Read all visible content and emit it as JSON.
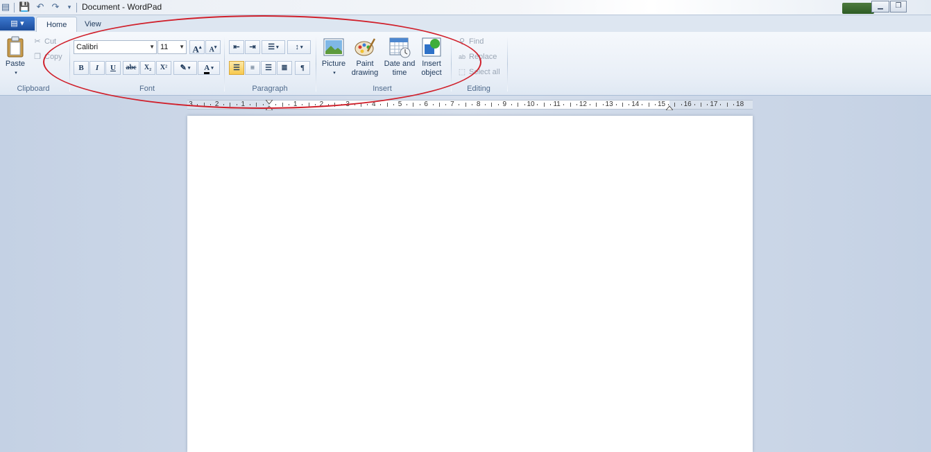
{
  "window": {
    "title": "Document - WordPad",
    "controls": {
      "minimize": "▁",
      "maximize": "❐"
    }
  },
  "tabs": [
    {
      "label": "Home",
      "active": true
    },
    {
      "label": "View",
      "active": false
    }
  ],
  "clipboard": {
    "group_label": "Clipboard",
    "paste": "Paste",
    "cut": "Cut",
    "copy": "Copy"
  },
  "font": {
    "group_label": "Font",
    "family": "Calibri",
    "size": "11",
    "grow": "A",
    "shrink": "A",
    "bold": "B",
    "italic": "I",
    "underline": "U",
    "strikethrough": "abc",
    "subscript": "X₂",
    "superscript": "X²",
    "font_color": "A"
  },
  "paragraph": {
    "group_label": "Paragraph"
  },
  "insert": {
    "group_label": "Insert",
    "picture": "Picture",
    "paint_line1": "Paint",
    "paint_line2": "drawing",
    "date_line1": "Date and",
    "date_line2": "time",
    "object_line1": "Insert",
    "object_line2": "object"
  },
  "editing": {
    "group_label": "Editing",
    "find": "Find",
    "replace": "Replace",
    "select_all": "Select all"
  },
  "ruler": {
    "left_numbers": [
      "3",
      "2",
      "1"
    ],
    "right_numbers": [
      "1",
      "2",
      "3",
      "4",
      "5",
      "6",
      "7",
      "8",
      "9",
      "10",
      "11",
      "12",
      "13",
      "14",
      "15",
      "16",
      "17",
      "18"
    ]
  },
  "colors": {
    "accent": "#1c4c9b",
    "annotation": "#d0202b",
    "ribbon_text": "#1e395b",
    "disabled_text": "#9aa6b5"
  }
}
